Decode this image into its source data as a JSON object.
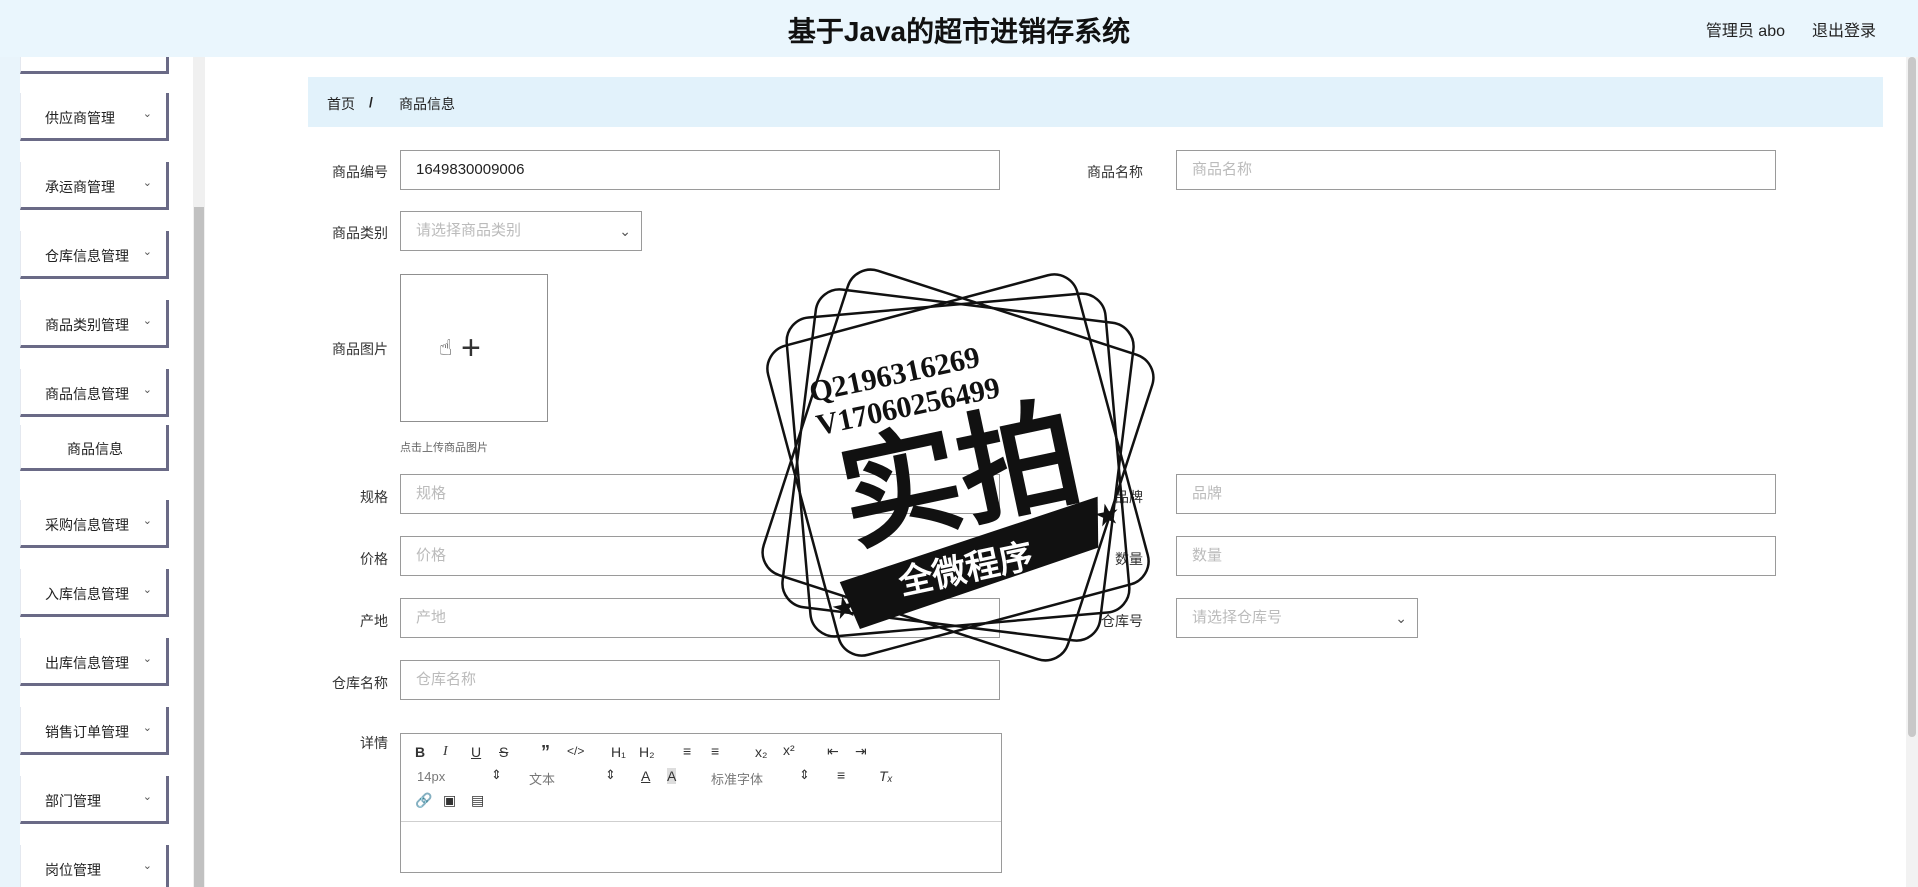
{
  "header": {
    "title": "基于Java的超市进销存系统",
    "user": "管理员 abo",
    "logout": "退出登录"
  },
  "sidebar": {
    "items": [
      {
        "label": "供应商管理"
      },
      {
        "label": "承运商管理"
      },
      {
        "label": "仓库信息管理"
      },
      {
        "label": "商品类别管理"
      },
      {
        "label": "商品信息管理"
      },
      {
        "label": "商品信息"
      },
      {
        "label": "采购信息管理"
      },
      {
        "label": "入库信息管理"
      },
      {
        "label": "出库信息管理"
      },
      {
        "label": "销售订单管理"
      },
      {
        "label": "部门管理"
      },
      {
        "label": "岗位管理"
      }
    ]
  },
  "breadcrumb": {
    "home": "首页",
    "separator": "/",
    "current": "商品信息"
  },
  "form": {
    "product_no": {
      "label": "商品编号",
      "value": "1649830009006"
    },
    "product_name": {
      "label": "商品名称",
      "placeholder": "商品名称"
    },
    "category": {
      "label": "商品类别",
      "placeholder": "请选择商品类别"
    },
    "image": {
      "label": "商品图片",
      "hint": "点击上传商品图片"
    },
    "spec": {
      "label": "规格",
      "placeholder": "规格"
    },
    "brand": {
      "label": "品牌",
      "placeholder": "品牌"
    },
    "price": {
      "label": "价格",
      "placeholder": "价格"
    },
    "quantity": {
      "label": "数量",
      "placeholder": "数量"
    },
    "origin": {
      "label": "产地",
      "placeholder": "产地"
    },
    "warehouse_no": {
      "label": "仓库号",
      "placeholder": "请选择仓库号"
    },
    "warehouse_name": {
      "label": "仓库名称",
      "placeholder": "仓库名称"
    },
    "detail": {
      "label": "详情"
    }
  },
  "editor": {
    "font_size": "14px",
    "paragraph": "文本",
    "font_family": "标准字体"
  },
  "watermark": {
    "line1": "Q2196316269",
    "line2": "V17060256499",
    "big": "实拍",
    "banner": "全微程序"
  }
}
